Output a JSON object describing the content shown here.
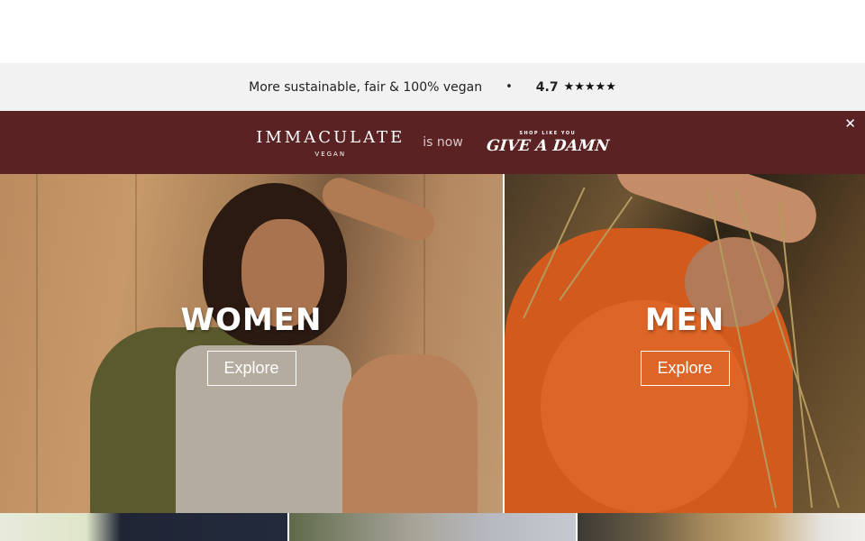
{
  "usp_bar": {
    "text": "More sustainable, fair & 100% vegan",
    "separator": "•",
    "rating": "4.7",
    "stars": "★★★★★",
    "star_color": "#111111"
  },
  "promo_banner": {
    "background": "#5a2223",
    "old_brand": {
      "name": "IMMACULATE",
      "sub": "VEGAN"
    },
    "connector": "is now",
    "new_brand": {
      "tagline": "SHOP LIKE YOU",
      "name": "GIVE A DAMN"
    },
    "close_symbol": "✕"
  },
  "heroes": [
    {
      "id": "women",
      "title": "WOMEN",
      "cta": "Explore"
    },
    {
      "id": "men",
      "title": "MEN",
      "cta": "Explore"
    }
  ]
}
